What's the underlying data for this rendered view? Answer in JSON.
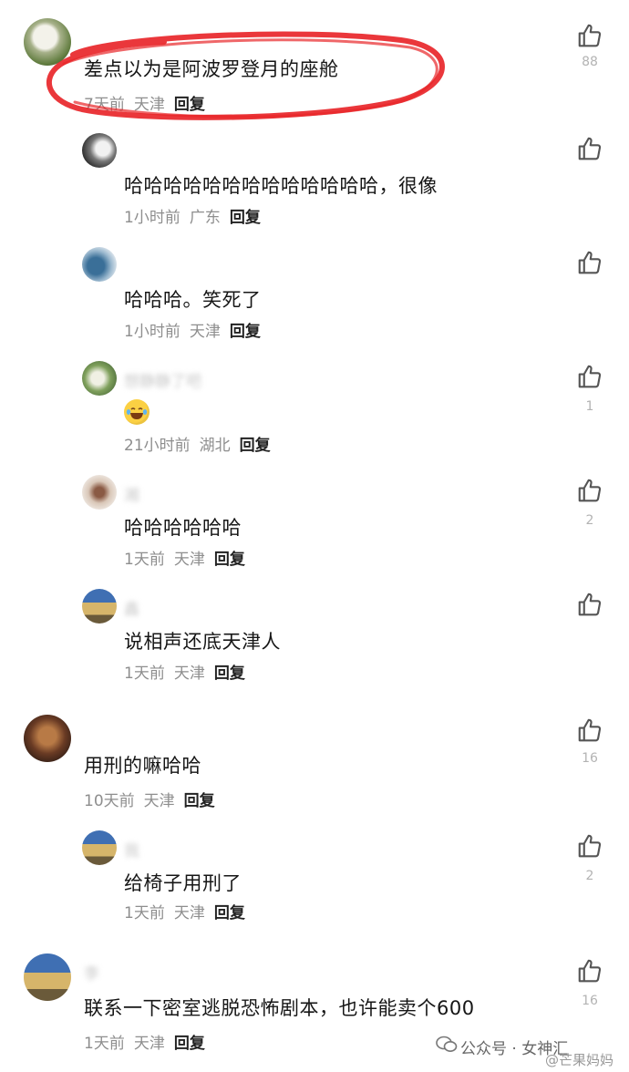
{
  "comments": [
    {
      "text": "差点以为是阿波罗登月的座舱",
      "time": "7天前",
      "location": "天津",
      "reply": "回复",
      "likes": "88",
      "username": ""
    },
    {
      "text": "哈哈哈哈哈哈哈哈哈哈哈哈哈，很像",
      "time": "1小时前",
      "location": "广东",
      "reply": "回复",
      "likes": "",
      "username": ""
    },
    {
      "text": "哈哈哈。笑死了",
      "time": "1小时前",
      "location": "天津",
      "reply": "回复",
      "likes": "",
      "username": ""
    },
    {
      "text": "",
      "emoji": "laughing-tears",
      "time": "21小时前",
      "location": "湖北",
      "reply": "回复",
      "likes": "1",
      "username": "想静静了吧"
    },
    {
      "text": "哈哈哈哈哈哈",
      "time": "1天前",
      "location": "天津",
      "reply": "回复",
      "likes": "2",
      "username": "湘"
    },
    {
      "text": "说相声还底天津人",
      "time": "1天前",
      "location": "天津",
      "reply": "回复",
      "likes": "",
      "username": "鑫"
    },
    {
      "text": "用刑的嘛哈哈",
      "time": "10天前",
      "location": "天津",
      "reply": "回复",
      "likes": "16",
      "username": ""
    },
    {
      "text": "给椅子用刑了",
      "time": "1天前",
      "location": "天津",
      "reply": "回复",
      "likes": "2",
      "username": "我"
    },
    {
      "text": "联系一下密室逃脱恐怖剧本，也许能卖个600",
      "time": "1天前",
      "location": "天津",
      "reply": "回复",
      "likes": "16",
      "username": "李"
    }
  ],
  "watermark": {
    "text": "公众号 · 女神汇",
    "weibo": "@芒果妈妈"
  },
  "colors": {
    "annotation_red": "#e8262a",
    "meta_gray": "#8e8e8e",
    "count_gray": "#b3b3b3"
  },
  "icons": {
    "like": "thumbs-up-outline-icon",
    "wechat": "wechat-logo-icon"
  }
}
